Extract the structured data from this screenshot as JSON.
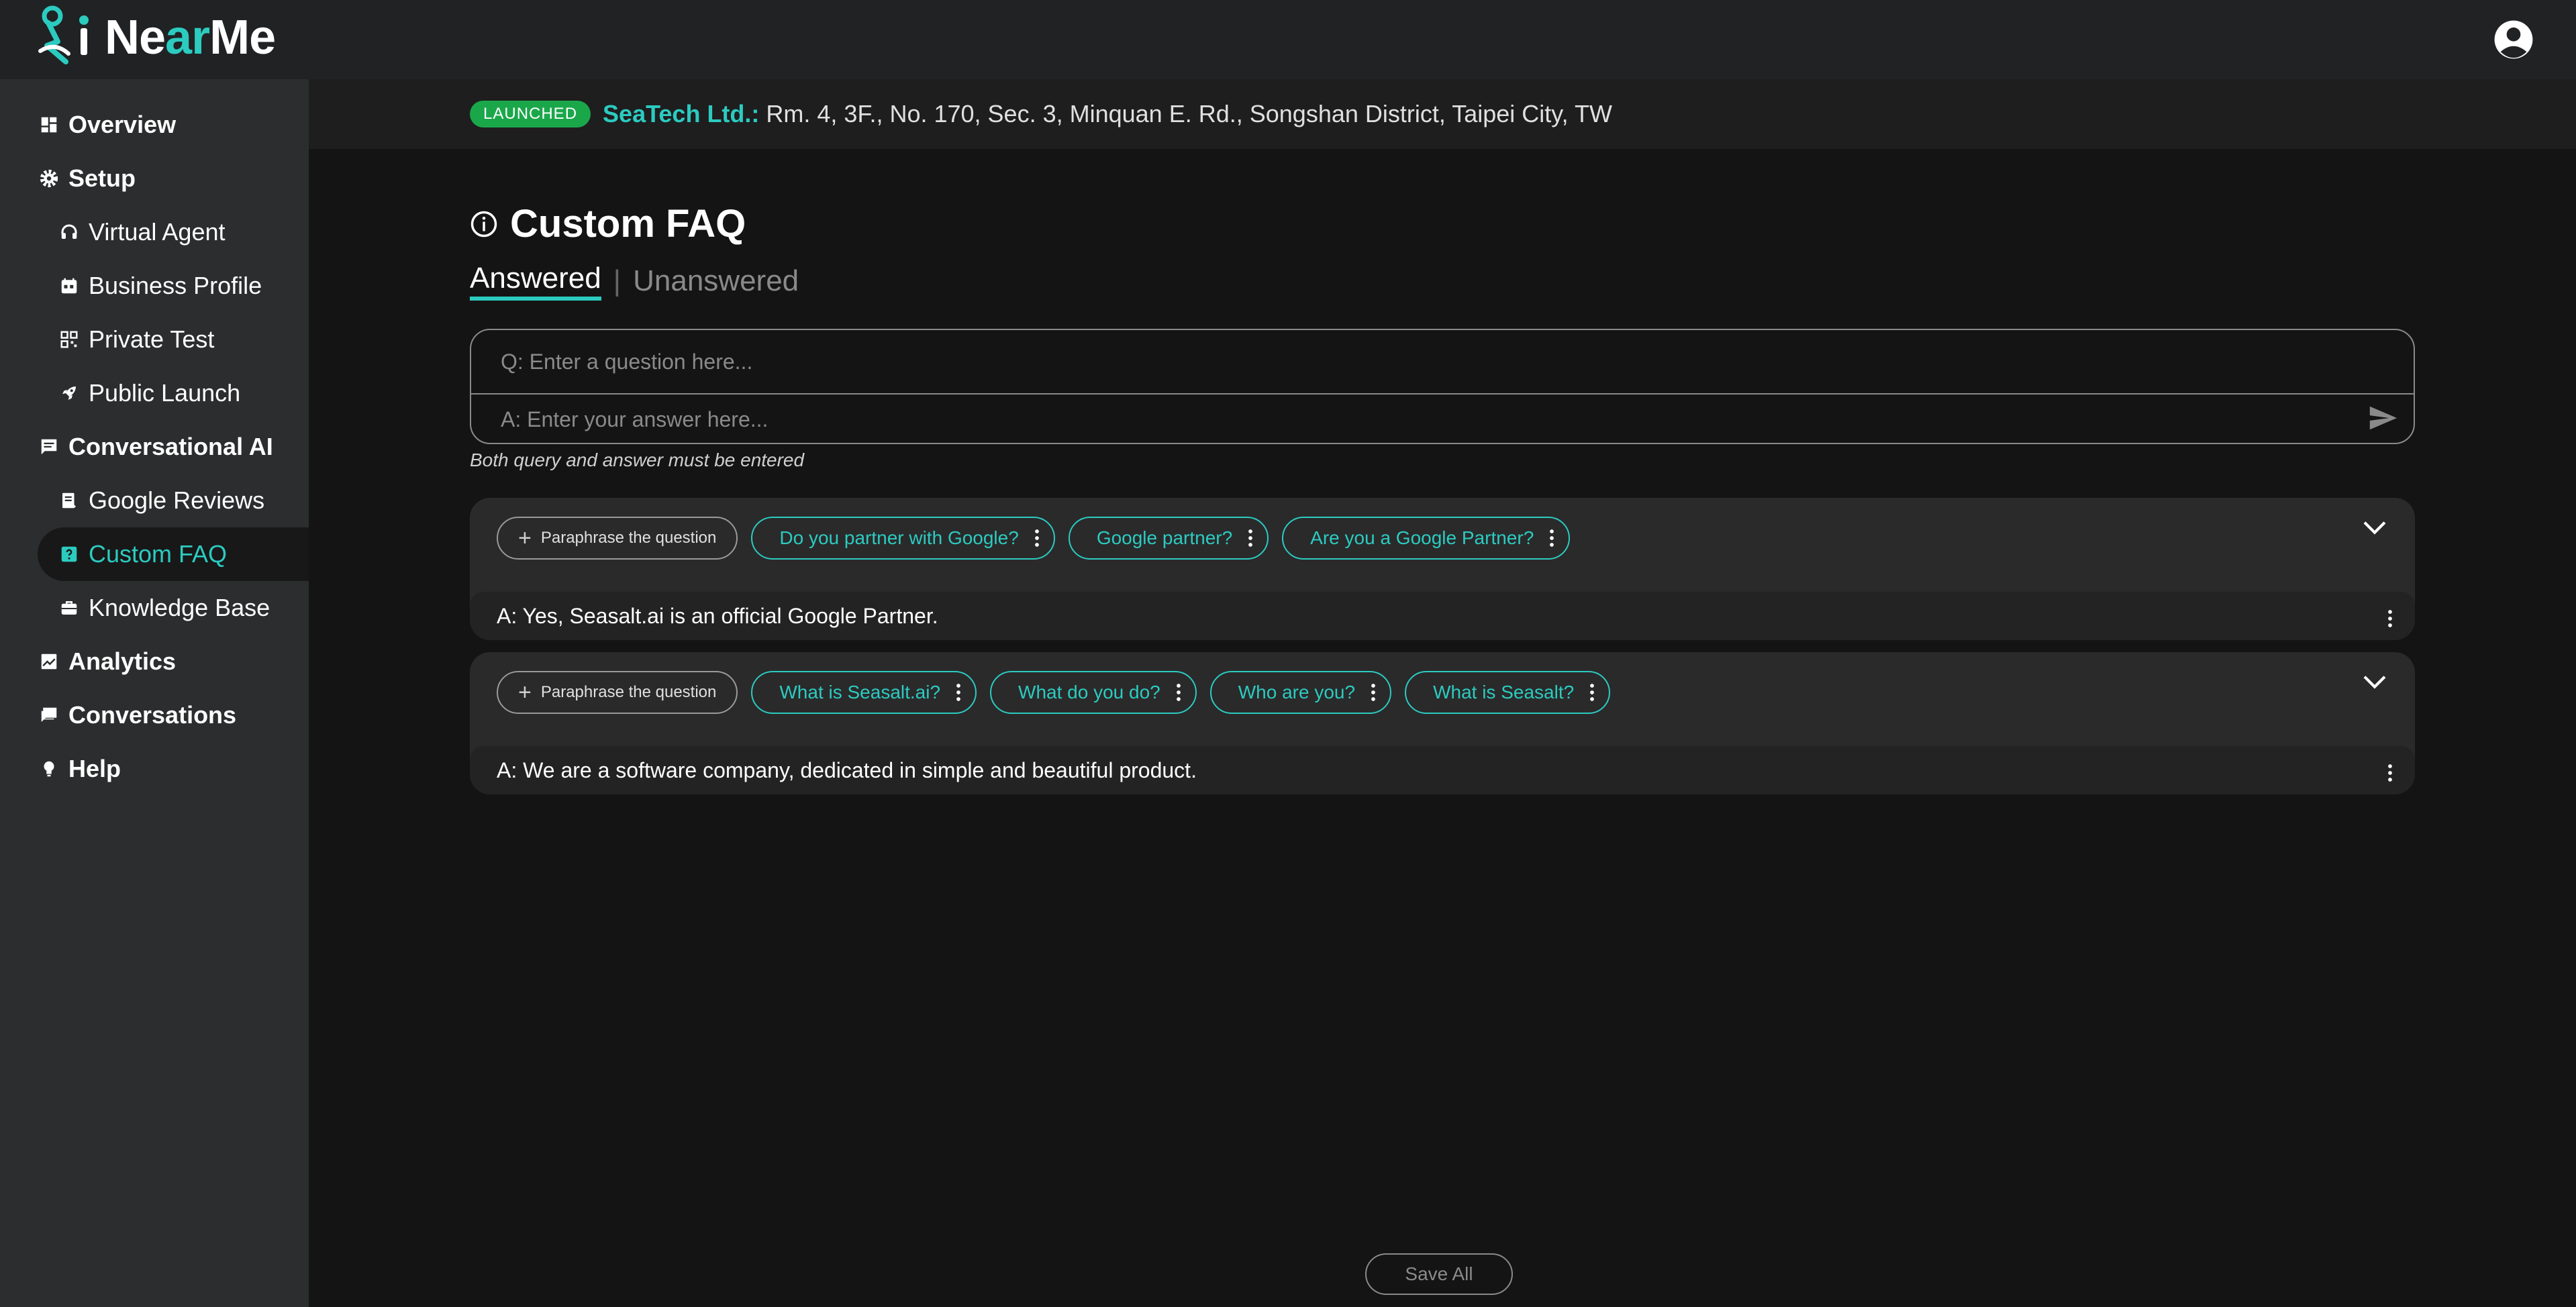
{
  "app": {
    "logo_text_white_a": "Ne",
    "logo_text_teal": "ar",
    "logo_text_white_b": "Me",
    "accent_color": "#2ccbc0"
  },
  "sidebar": {
    "items": [
      {
        "label": "Overview",
        "icon": "dashboard-icon"
      },
      {
        "label": "Setup",
        "icon": "gear-icon"
      },
      {
        "label": "Virtual Agent",
        "icon": "headset-icon"
      },
      {
        "label": "Business Profile",
        "icon": "calendar-icon"
      },
      {
        "label": "Private Test",
        "icon": "qr-code-icon"
      },
      {
        "label": "Public Launch",
        "icon": "rocket-icon"
      },
      {
        "label": "Conversational AI",
        "icon": "chat-icon"
      },
      {
        "label": "Google Reviews",
        "icon": "review-icon"
      },
      {
        "label": "Custom FAQ",
        "icon": "faq-icon"
      },
      {
        "label": "Knowledge Base",
        "icon": "briefcase-icon"
      },
      {
        "label": "Analytics",
        "icon": "chart-icon"
      },
      {
        "label": "Conversations",
        "icon": "conversations-icon"
      },
      {
        "label": "Help",
        "icon": "lightbulb-icon"
      }
    ]
  },
  "banner": {
    "badge": "LAUNCHED",
    "company": "SeaTech Ltd.:",
    "address": "Rm. 4, 3F., No. 170, Sec. 3, Minquan E. Rd., Songshan District, Taipei City, TW"
  },
  "page": {
    "title": "Custom FAQ",
    "tabs": {
      "answered": "Answered",
      "separator": "|",
      "unanswered": "Unanswered"
    }
  },
  "form": {
    "question_placeholder": "Q: Enter a question here...",
    "answer_placeholder": "A: Enter your answer here...",
    "hint": "Both query and answer must be entered"
  },
  "faqs": [
    {
      "paraphrase_label": "Paraphrase the question",
      "questions": [
        "Do you partner with Google?",
        "Google partner?",
        "Are you a Google Partner?"
      ],
      "answer": "A: Yes, Seasalt.ai is an official Google Partner."
    },
    {
      "paraphrase_label": "Paraphrase the question",
      "questions": [
        "What is Seasalt.ai?",
        "What do you do?",
        "Who are you?",
        "What is Seasalt?"
      ],
      "answer": "A: We are a software company, dedicated in simple and beautiful product."
    }
  ],
  "footer": {
    "save_all": "Save All"
  }
}
